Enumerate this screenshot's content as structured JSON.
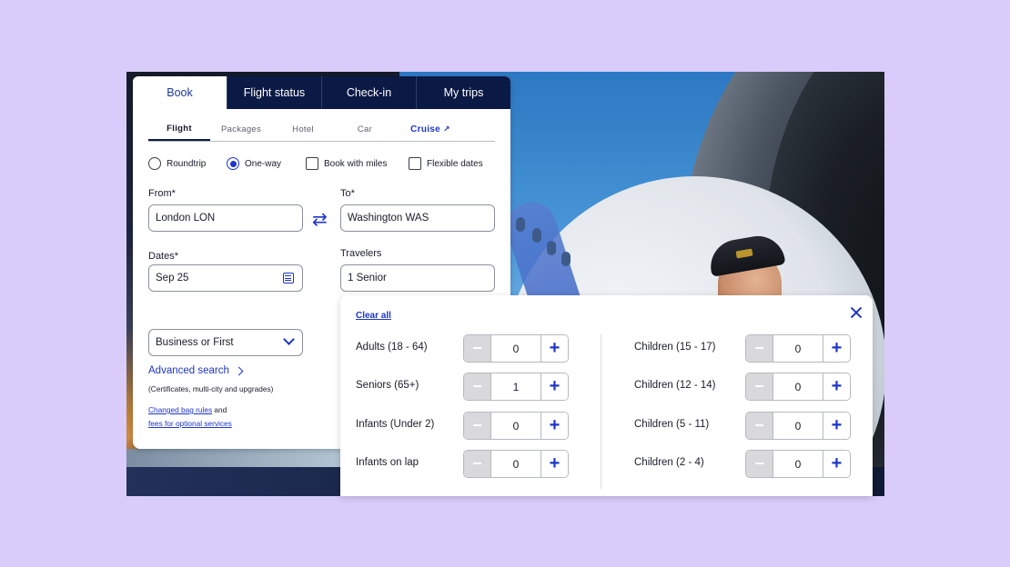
{
  "main_tabs": [
    "Book",
    "Flight status",
    "Check-in",
    "My trips"
  ],
  "sub_tabs": [
    "Flight",
    "Packages",
    "Hotel",
    "Car",
    "Cruise"
  ],
  "trip_options": {
    "roundtrip": "Roundtrip",
    "oneway": "One-way",
    "miles": "Book with miles",
    "flexible": "Flexible dates"
  },
  "form": {
    "from_label": "From*",
    "from_value": "London LON",
    "to_label": "To*",
    "to_value": "Washington WAS",
    "dates_label": "Dates*",
    "dates_value": "Sep 25",
    "travelers_label": "Travelers",
    "travelers_value": "1 Senior",
    "cabin_value": "Business or First"
  },
  "advanced_search": "Advanced search",
  "advanced_note": "(Certificates, multi-city and upgrades)",
  "bag": {
    "link1": "Changed bag rules",
    "and": " and",
    "link2": "fees for optional services"
  },
  "popup": {
    "clear_all": "Clear all",
    "rows": [
      {
        "label": "Adults (18 - 64)",
        "value": "0"
      },
      {
        "label": "Seniors (65+)",
        "value": "1"
      },
      {
        "label": "Infants (Under 2)",
        "value": "0"
      },
      {
        "label": "Infants on lap",
        "value": "0"
      },
      {
        "label": "Children (15 - 17)",
        "value": "0"
      },
      {
        "label": "Children (12 - 14)",
        "value": "0"
      },
      {
        "label": "Children (5 - 11)",
        "value": "0"
      },
      {
        "label": "Children (2 - 4)",
        "value": "0"
      }
    ]
  },
  "colors": {
    "accent": "#1d35c8",
    "nav_dark": "#0b1a45",
    "background": "#d9ccfb"
  }
}
